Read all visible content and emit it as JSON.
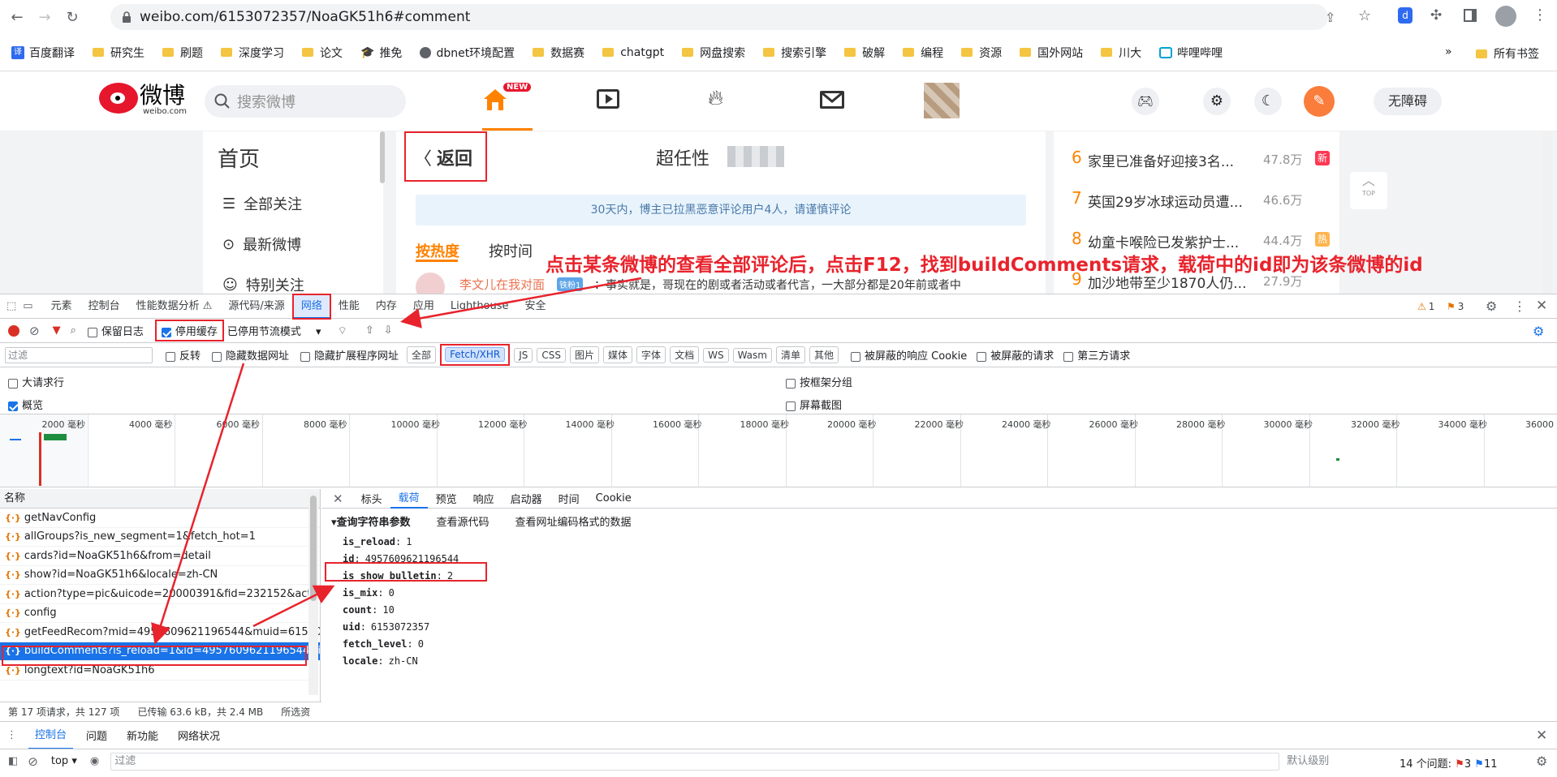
{
  "browser": {
    "url": "weibo.com/6153072357/NoaGK51h6#comment",
    "bookmarks": [
      "百度翻译",
      "研究生",
      "刷题",
      "深度学习",
      "论文",
      "推免",
      "dbnet环境配置",
      "数据赛",
      "chatgpt",
      "网盘搜索",
      "搜索引擎",
      "破解",
      "编程",
      "资源",
      "国外网站",
      "川大",
      "哔哩哔哩"
    ],
    "bookmarks_overflow": "»",
    "all_bookmarks": "所有书签"
  },
  "weibo": {
    "logo_text": "微博",
    "logo_sub": "weibo.com",
    "search_placeholder": "搜索微博",
    "new_badge": "NEW",
    "accessibility": "无障碍",
    "nav_title": "首页",
    "nav_items": [
      "全部关注",
      "最新微博",
      "特别关注"
    ],
    "back": "返回",
    "post_title": "超任性",
    "notice": "30天内，博主已拉黑恶意评论用户4人，请谨慎评论",
    "sort_hot": "按热度",
    "sort_time": "按时间",
    "comment_user": "李文儿在我对面",
    "comment_badge": "铁粉1",
    "comment_text": "：事实就是，哥现在的剧或者活动或者代言，一大部分都是20年前或者中",
    "top_label": "TOP",
    "hot": [
      {
        "rank": "6",
        "text": "家里已准备好迎接3名...",
        "count": "47.8万",
        "badge": "新"
      },
      {
        "rank": "7",
        "text": "英国29岁冰球运动员遭...",
        "count": "46.6万",
        "badge": ""
      },
      {
        "rank": "8",
        "text": "幼童卡喉险已发紫护士...",
        "count": "44.4万",
        "badge": "热"
      },
      {
        "rank": "9",
        "text": "加沙地带至少1870人仍...",
        "count": "27.9万",
        "badge": ""
      }
    ]
  },
  "annotation": "点击某条微博的查看全部评论后，点击F12，找到buildComments请求，载荷中的id即为该条微博的id",
  "devtools": {
    "tabs": [
      "元素",
      "控制台",
      "性能数据分析 ⚠",
      "源代码/来源",
      "网络",
      "性能",
      "内存",
      "应用",
      "Lighthouse",
      "安全"
    ],
    "active_tab": "网络",
    "warnings": "1",
    "issues": "3",
    "toolbar": {
      "preserve_log": "保留日志",
      "disable_cache": "停用缓存",
      "throttle": "已停用节流模式"
    },
    "filter": {
      "placeholder": "过滤",
      "invert": "反转",
      "hide_data": "隐藏数据网址",
      "hide_ext": "隐藏扩展程序网址",
      "types": [
        "全部",
        "Fetch/XHR",
        "JS",
        "CSS",
        "图片",
        "媒体",
        "字体",
        "文档",
        "WS",
        "Wasm",
        "清单",
        "其他"
      ],
      "active_type": "Fetch/XHR",
      "blocked_cookie": "被屏蔽的响应 Cookie",
      "blocked_req": "被屏蔽的请求",
      "third_party": "第三方请求"
    },
    "options": {
      "big_rows": "大请求行",
      "overview": "概览",
      "group_by_frame": "按框架分组",
      "screenshots": "屏幕截图"
    },
    "timeline_ticks": [
      "2000 毫秒",
      "4000 毫秒",
      "6000 毫秒",
      "8000 毫秒",
      "10000 毫秒",
      "12000 毫秒",
      "14000 毫秒",
      "16000 毫秒",
      "18000 毫秒",
      "20000 毫秒",
      "22000 毫秒",
      "24000 毫秒",
      "26000 毫秒",
      "28000 毫秒",
      "30000 毫秒",
      "32000 毫秒",
      "34000 毫秒",
      "36000 毫秒"
    ],
    "name_header": "名称",
    "requests": [
      "getNavConfig",
      "allGroups?is_new_segment=1&fetch_hot=1",
      "cards?id=NoaGK51h6&from=detail",
      "show?id=NoaGK51h6&locale=zh-CN",
      "action?type=pic&uicode=20000391&fid=232152&act_co...",
      "config",
      "getFeedRecom?mid=4957609621196544&muid=615307...",
      "buildComments?is_reload=1&id=4957609621196544&is...",
      "longtext?id=NoaGK51h6"
    ],
    "selected_index": 7,
    "detail_tabs": [
      "标头",
      "载荷",
      "预览",
      "响应",
      "启动器",
      "时间",
      "Cookie"
    ],
    "active_detail": "载荷",
    "payload_section": "▾查询字符串参数",
    "view_source": "查看源代码",
    "view_decoded": "查看网址编码格式的数据",
    "params": [
      {
        "k": "is_reload",
        "v": "1"
      },
      {
        "k": "id",
        "v": "4957609621196544"
      },
      {
        "k": "is_show_bulletin",
        "v": "2"
      },
      {
        "k": "is_mix",
        "v": "0"
      },
      {
        "k": "count",
        "v": "10"
      },
      {
        "k": "uid",
        "v": "6153072357"
      },
      {
        "k": "fetch_level",
        "v": "0"
      },
      {
        "k": "locale",
        "v": "zh-CN"
      }
    ],
    "status": {
      "requests": "第 17 项请求，共 127 项",
      "transferred": "已传输 63.6 kB，共 2.4 MB",
      "selected": "所选资"
    },
    "drawer_tabs": [
      "控制台",
      "问题",
      "新功能",
      "网络状况"
    ],
    "console": {
      "context": "top",
      "filter": "过滤",
      "level": "默认级别",
      "issues_label": "14 个问题:",
      "issues_a": "3",
      "issues_b": "11"
    }
  }
}
